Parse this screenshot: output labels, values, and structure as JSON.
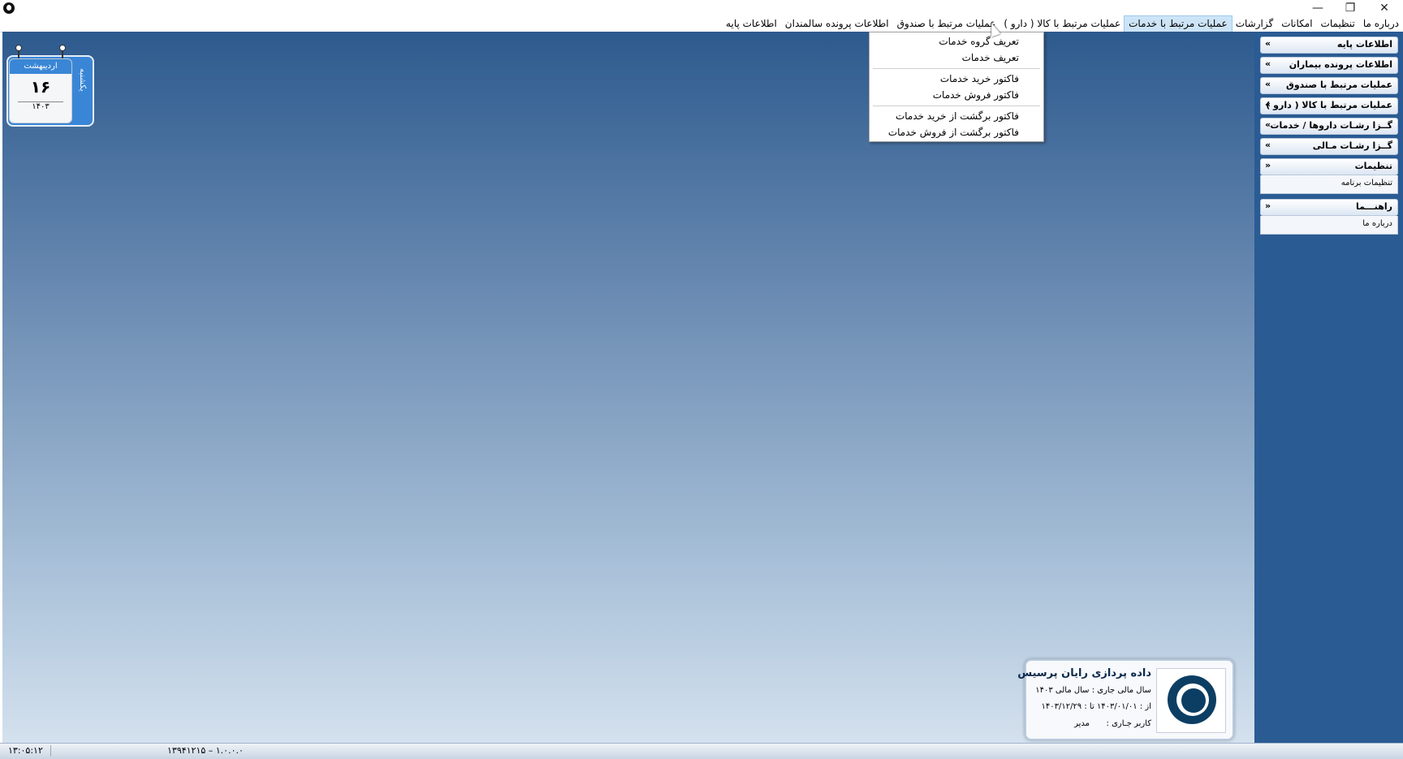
{
  "window": {
    "minimize_glyph": "—",
    "restore_glyph": "❐",
    "close_glyph": "✕"
  },
  "menubar": {
    "items": [
      "اطلاعات پایه",
      "اطلاعات پرونده سالمندان",
      "عملیات مرتبط با صندوق",
      "عملیات مرتبط با کالا ( دارو )",
      "عملیات مرتبط با خدمات",
      "گزارشات",
      "امکانات",
      "تنظیمات",
      "درباره ما"
    ],
    "active_index": 4
  },
  "dropdown": {
    "items": [
      "تعریف گروه خدمات",
      "تعریف خدمات",
      "فاکتور خرید خدمات",
      "فاکتور فروش خدمات",
      "فاکتور برگشت از خرید خدمات",
      "فاکتور برگشت از فروش خدمات"
    ]
  },
  "sidebar": {
    "groups": [
      {
        "title": "اطلاعات پایه",
        "expanded": false
      },
      {
        "title": "اطلاعات پرونده بیماران",
        "expanded": false
      },
      {
        "title": "عملیات مرتبط با صندوق",
        "expanded": false
      },
      {
        "title": "عملیات مرتبط با کالا ( دارو )",
        "expanded": false
      },
      {
        "title": "گــزا رشـات داروها / خدمات",
        "expanded": false
      },
      {
        "title": "گــزا رشـات مـالی",
        "expanded": false
      },
      {
        "title": "تنظیمات",
        "expanded": true,
        "child": "تنظیمات برنامه"
      },
      {
        "title": "راهنـــما",
        "expanded": true,
        "child": "درباره ما"
      }
    ],
    "collapsed_chevron": "»",
    "expanded_chevron": "«"
  },
  "calendar": {
    "month": "اردیبهشت",
    "day": "۱۶",
    "year": "۱۴۰۳",
    "weekday": "یکشنبه"
  },
  "info": {
    "company": "داده پردازی رایان پرسیس",
    "fiscal_label": "سال مالی جاری  :  سال مالی ۱۴۰۳",
    "range_label": "از :  ۱۴۰۳/۰۱/۰۱   تا :  ۱۴۰۳/۱۲/۲۹",
    "user_label": "کاربر جـاری :",
    "user_value": "مدیر"
  },
  "status": {
    "time": "۱۳:۰۵:۱۲",
    "version": "۱۳۹۴۱۲۱۵ – ۱.۰.۰.۰"
  }
}
